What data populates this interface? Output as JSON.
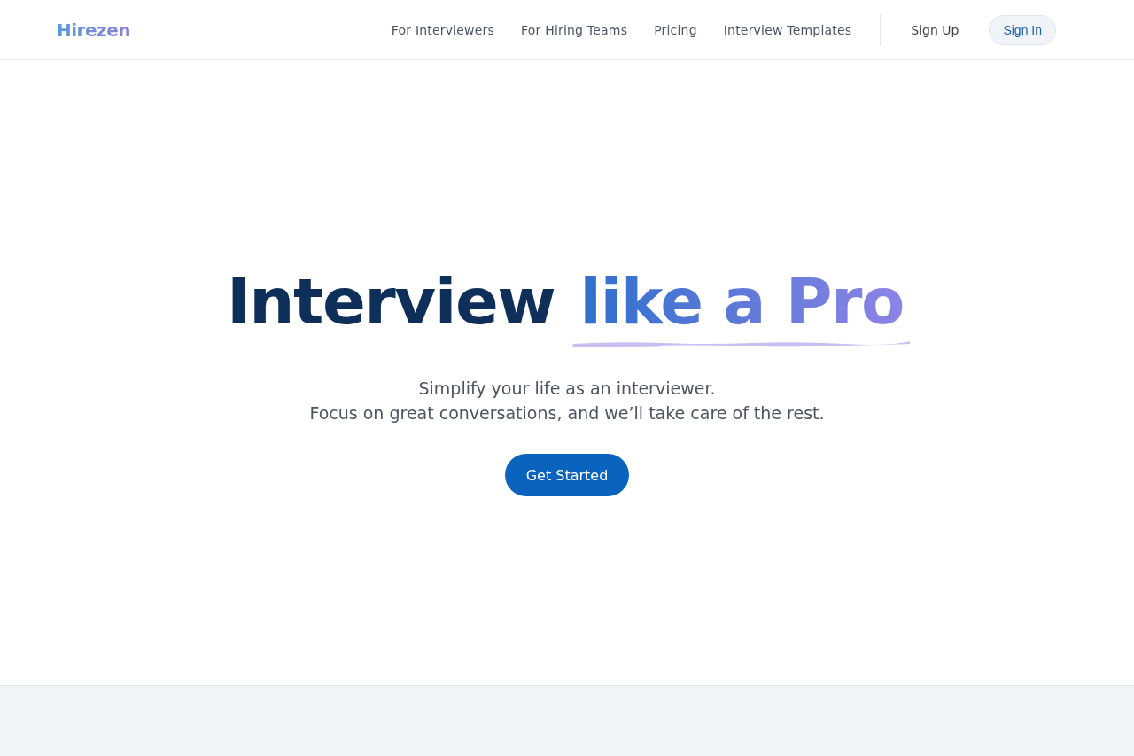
{
  "header": {
    "logo": "Hirezen",
    "nav": [
      {
        "label": "For Interviewers"
      },
      {
        "label": "For Hiring Teams"
      },
      {
        "label": "Pricing"
      },
      {
        "label": "Interview Templates"
      }
    ],
    "sign_up": "Sign Up",
    "sign_in": "Sign In"
  },
  "hero": {
    "title_plain": "Interview",
    "title_highlight": "like a Pro",
    "subtitle_lines": [
      "Simplify your life as an interviewer.",
      "Focus on great conversations, and we’ll take care of the rest."
    ],
    "cta": "Get Started"
  }
}
